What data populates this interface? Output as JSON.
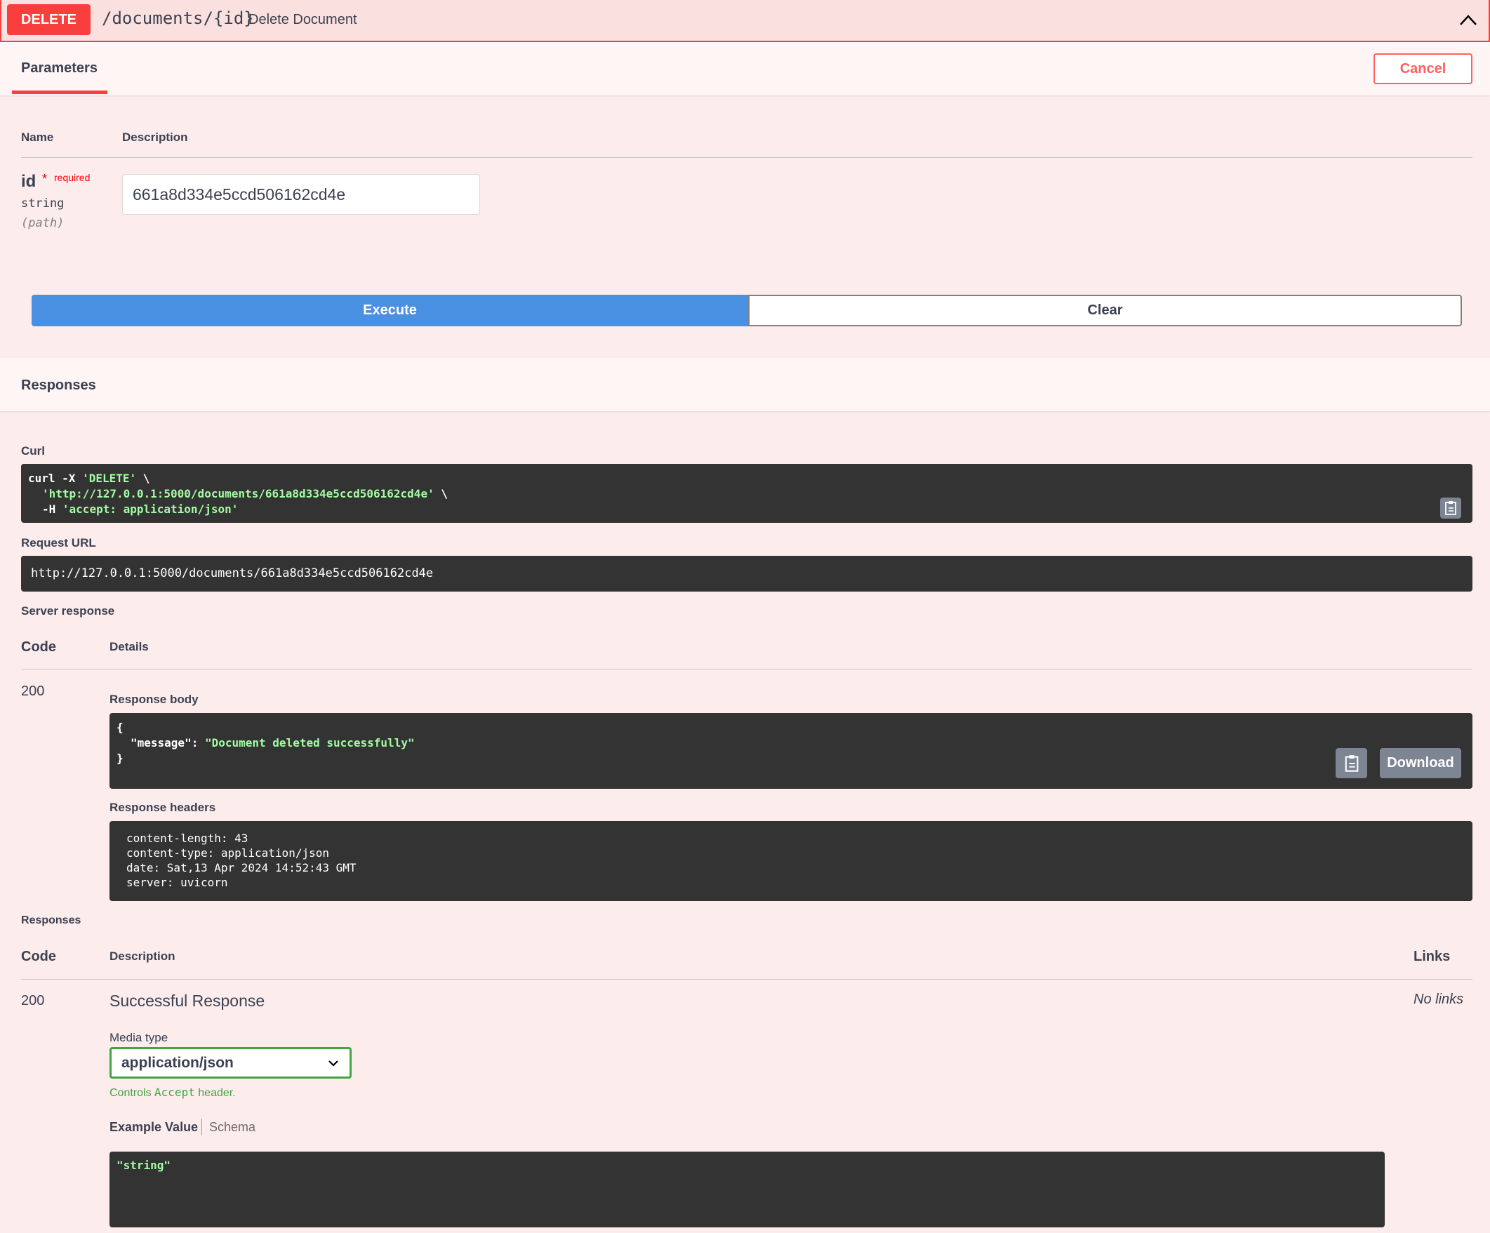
{
  "op": {
    "method": "DELETE",
    "path": "/documents/{id}",
    "summary": "Delete Document"
  },
  "params": {
    "tab": "Parameters",
    "cancel": "Cancel",
    "col_name": "Name",
    "col_desc": "Description",
    "name": "id",
    "required_star": "*",
    "required_text": "required",
    "type": "string",
    "in": "(path)",
    "value": "661a8d334e5ccd506162cd4e",
    "execute": "Execute",
    "clear": "Clear"
  },
  "responses_section": {
    "title": "Responses",
    "curl_label": "Curl",
    "curl_line1_a": "curl -X ",
    "curl_line1_b": "'DELETE'",
    "curl_line1_c": " \\",
    "curl_line2_a": "'http://127.0.0.1:5000/documents/661a8d334e5ccd506162cd4e'",
    "curl_line2_b": " \\",
    "curl_line3_a": "-H ",
    "curl_line3_b": "'accept: application/json'",
    "request_url_label": "Request URL",
    "request_url": "http://127.0.0.1:5000/documents/661a8d334e5ccd506162cd4e",
    "server_response_label": "Server response",
    "col_code": "Code",
    "col_details": "Details",
    "code": "200",
    "body_label": "Response body",
    "body_open": "{",
    "body_key": "\"message\"",
    "body_colon": ": ",
    "body_value": "\"Document deleted successfully\"",
    "body_close": "}",
    "download": "Download",
    "headers_label": "Response headers",
    "headers": [
      "content-length: 43",
      "content-type: application/json",
      "date: Sat,13 Apr 2024 14:52:43 GMT",
      "server: uvicorn"
    ]
  },
  "responses_doc": {
    "label": "Responses",
    "col_code": "Code",
    "col_desc": "Description",
    "col_links": "Links",
    "code": "200",
    "description": "Successful Response",
    "links": "No links",
    "media_label": "Media type",
    "media_value": "application/json",
    "controls_a": "Controls ",
    "controls_b": "Accept",
    "controls_c": " header.",
    "example_tab": "Example Value",
    "schema_tab": "Schema",
    "example_value": "\"string\""
  },
  "colors": {
    "delete": "#f93e3e",
    "execute": "#4990e2",
    "code_bg": "#333333",
    "code_string": "#a2fca2",
    "select_border": "#41a541"
  }
}
